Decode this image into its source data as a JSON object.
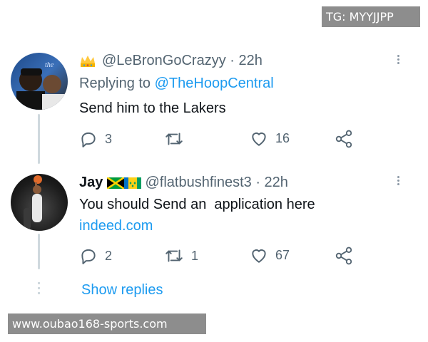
{
  "watermarks": {
    "top": "TG: MYYJJPP",
    "bottom": "www.oubao168-sports.com"
  },
  "colors": {
    "link": "#1d9bf0",
    "muted": "#536471",
    "text": "#0f1419"
  },
  "tweets": [
    {
      "display_name": "",
      "handle": "@LeBronGoCrazyy",
      "time": "· 22h",
      "replying_prefix": "Replying to",
      "replying_to": "@TheHoopCentral",
      "text": "Send him to the Lakers",
      "replies": "3",
      "retweets": "",
      "likes": "16",
      "badge_icon": "crown-emoji"
    },
    {
      "display_name": "Jay",
      "handle": "@flatbushfinest3",
      "time": "· 22h",
      "text": "You should Send an  application here",
      "link": "indeed.com",
      "replies": "2",
      "retweets": "1",
      "likes": "67",
      "flags": [
        "jamaica-flag",
        "saint-vincent-flag"
      ]
    }
  ],
  "show_replies": "Show replies"
}
